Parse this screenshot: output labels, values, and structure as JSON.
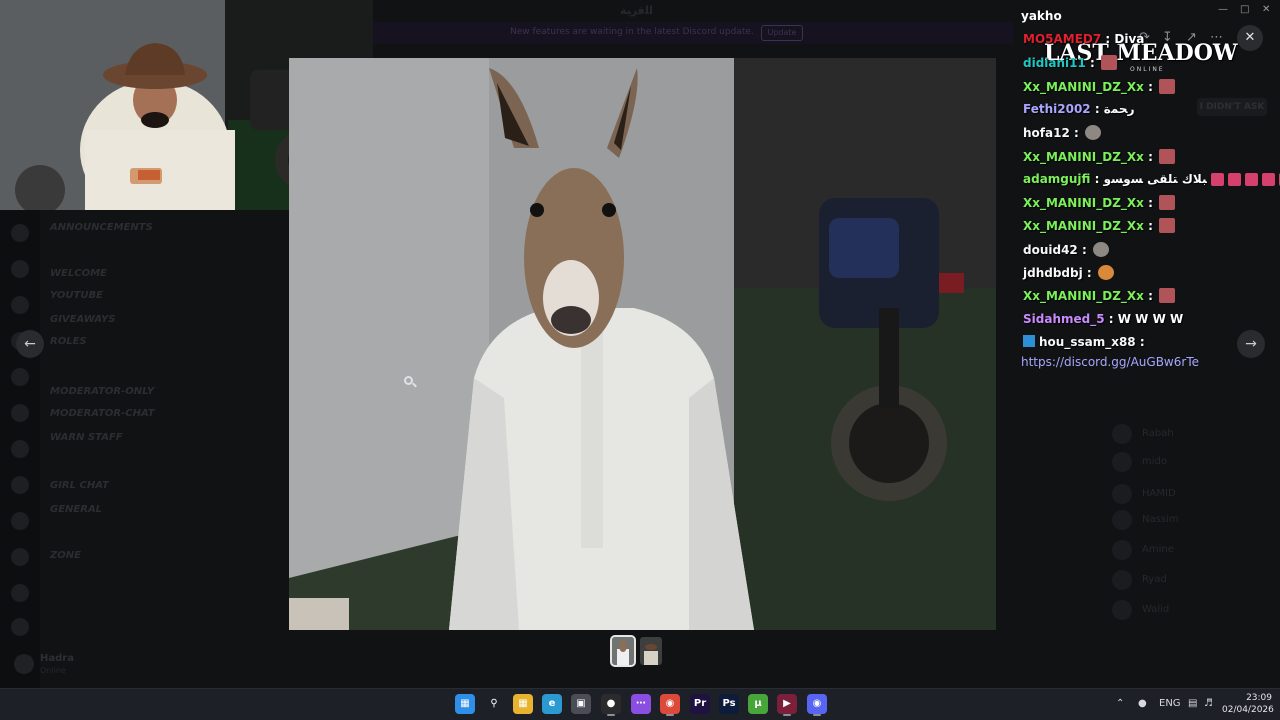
{
  "discord": {
    "title": "ﺍﻠﻗﺭﻴﺔ",
    "banner_text": "New features are waiting in the latest Discord update.",
    "banner_button": "Update",
    "channels": [
      "ANNOUNCEMENTS",
      "WELCOME",
      "YOUTUBE",
      "GIVEAWAYS",
      "ROLES",
      "MODERATOR-ONLY",
      "MODERATOR-CHAT",
      "WARN STAFF",
      "GIRL CHAT",
      "GENERAL",
      "ZONE"
    ],
    "user_name": "Hadra",
    "user_status": "Online",
    "members": [
      "I DIDN'T ASK",
      "Rabah",
      "mido",
      "HAMID",
      "Nassim",
      "Amine",
      "Ryad",
      "Walid"
    ]
  },
  "viewer": {
    "prev_icon": "arrow-left-icon",
    "next_icon": "arrow-right-icon",
    "close_icon": "close-icon",
    "tools": [
      "share-icon",
      "download-icon",
      "open-external-icon",
      "more-icon"
    ]
  },
  "overlay": {
    "logo_text": "LAST MEADOW",
    "logo_sub": "ONLINE"
  },
  "chat": {
    "title": "yakho",
    "messages": [
      {
        "user": "MO5AMED7",
        "color": "#e0202e",
        "text": "Diva",
        "emotes": []
      },
      {
        "user": "didiani11",
        "color": "#1fc7c2",
        "text": "",
        "emotes": [
          "red"
        ]
      },
      {
        "user": "Xx_MANINI_DZ_Xx",
        "color": "#7cf05a",
        "text": "",
        "emotes": [
          "red"
        ]
      },
      {
        "user": "Fethi2002",
        "color": "#a9a6ff",
        "text": "ﺭﺤﻤﺓ",
        "emotes": []
      },
      {
        "user": "hofa12",
        "color": "#f7f7f7",
        "text": "",
        "emotes": [
          "gray"
        ]
      },
      {
        "user": "Xx_MANINI_DZ_Xx",
        "color": "#7cf05a",
        "text": "",
        "emotes": [
          "red"
        ]
      },
      {
        "user": "adamgujfi",
        "color": "#7cf05a",
        "text": "ﺒﻼﻙ ﺘﻠﻘﻰ ﺴﻭﺴﻭ",
        "emotes": [
          "pink",
          "pink",
          "pink",
          "pink",
          "pink"
        ]
      },
      {
        "user": "Xx_MANINI_DZ_Xx",
        "color": "#7cf05a",
        "text": "",
        "emotes": [
          "red"
        ]
      },
      {
        "user": "Xx_MANINI_DZ_Xx",
        "color": "#7cf05a",
        "text": "",
        "emotes": [
          "red"
        ]
      },
      {
        "user": "douid42",
        "color": "#f7f7f7",
        "text": "",
        "emotes": [
          "gray"
        ]
      },
      {
        "user": "jdhdbdbj",
        "color": "#f7f7f7",
        "text": "",
        "emotes": [
          "face"
        ]
      },
      {
        "user": "Xx_MANINI_DZ_Xx",
        "color": "#7cf05a",
        "text": "",
        "emotes": [
          "red"
        ]
      },
      {
        "user": "Sidahmed_5",
        "color": "#c98bff",
        "text": "W W W W",
        "emotes": []
      },
      {
        "user": "hou_ssam_x88",
        "color": "#f7f7f7",
        "text": "",
        "emotes": []
      }
    ],
    "link": "https://discord.gg/AuGBw6rTe"
  },
  "taskbar": {
    "tray_lang": "ENG",
    "time": "23:09",
    "date": "02/04/2026",
    "icons": [
      "windows-start-icon",
      "search-icon",
      "file-explorer-icon",
      "edge-icon",
      "store-icon",
      "obs-icon",
      "messenger-icon",
      "chrome-icon",
      "premiere-icon",
      "photoshop-icon",
      "utorrent-icon",
      "media-player-icon",
      "discord-icon"
    ]
  }
}
